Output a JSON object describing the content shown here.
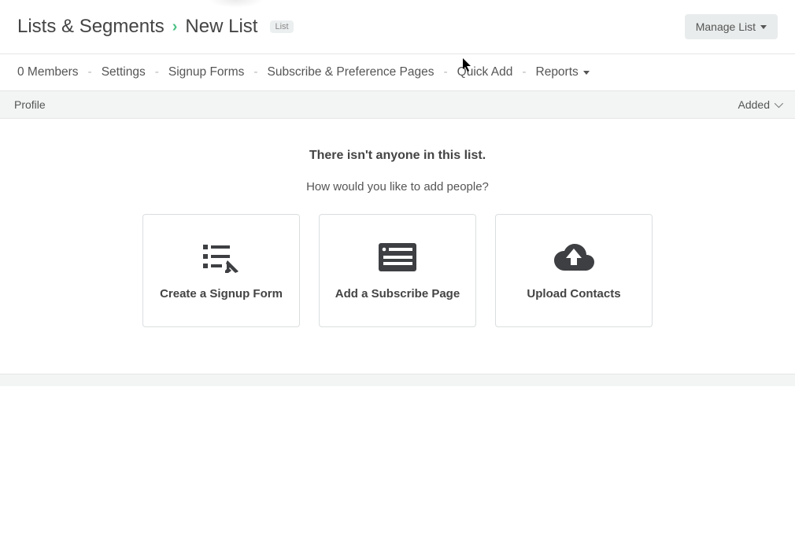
{
  "header": {
    "breadcrumb_parent": "Lists & Segments",
    "breadcrumb_current": "New List",
    "badge": "List",
    "manage_button_label": "Manage List"
  },
  "subnav": {
    "items": [
      "0 Members",
      "Settings",
      "Signup Forms",
      "Subscribe & Preference Pages",
      "Quick Add",
      "Reports"
    ]
  },
  "table_header": {
    "left": "Profile",
    "right": "Added"
  },
  "empty_state": {
    "title": "There isn't anyone in this list.",
    "subtitle": "How would you like to add people?",
    "cards": [
      {
        "label": "Create a Signup Form",
        "icon": "form-icon"
      },
      {
        "label": "Add a Subscribe Page",
        "icon": "page-icon"
      },
      {
        "label": "Upload Contacts",
        "icon": "cloud-upload-icon"
      }
    ]
  }
}
